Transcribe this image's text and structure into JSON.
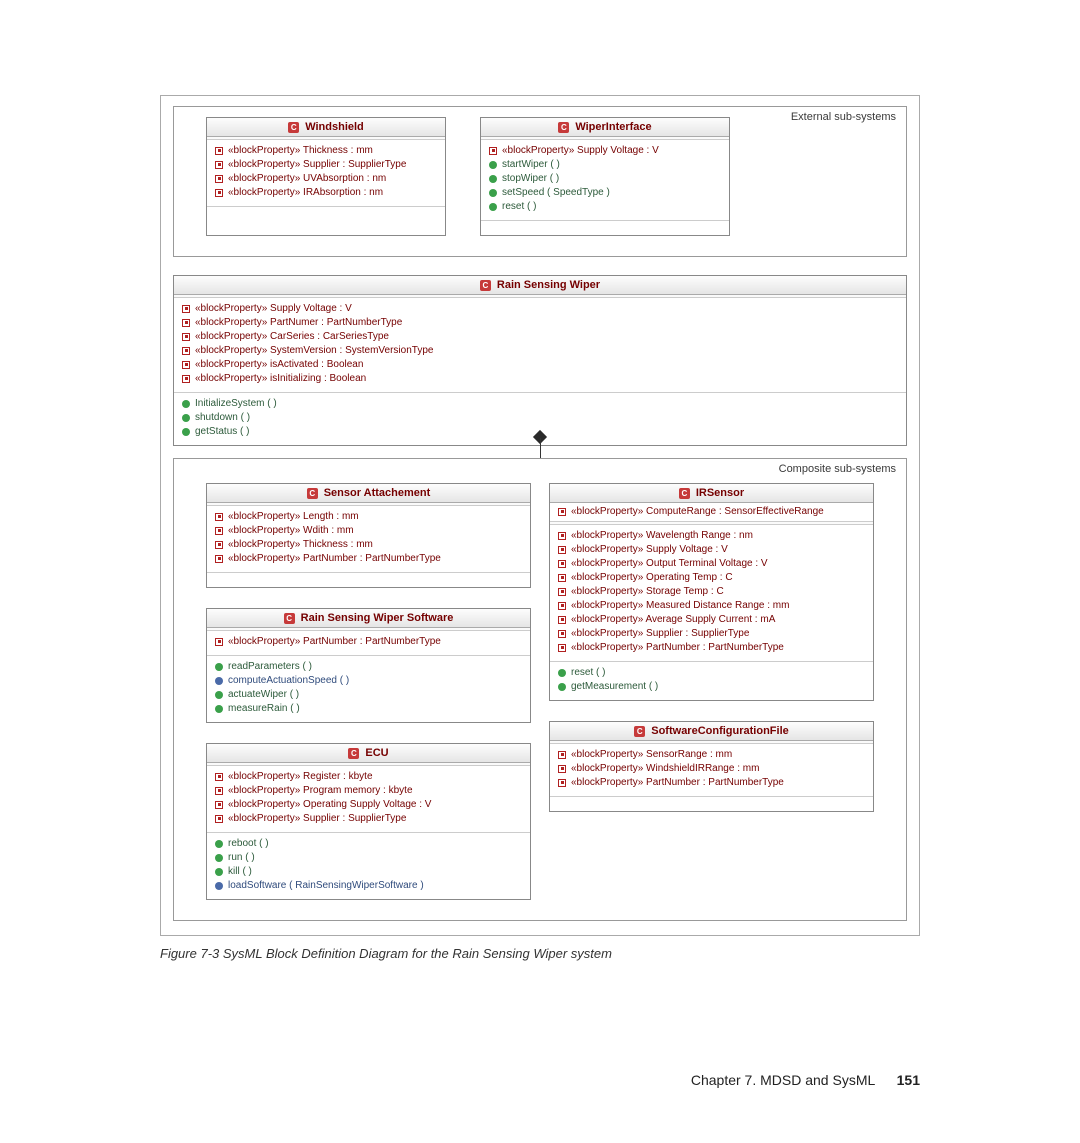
{
  "caption": "Figure 7-3   SysML Block Definition Diagram for the Rain Sensing Wiper system",
  "footer_chapter": "Chapter 7. MDSD and SysML",
  "footer_page": "151",
  "pkg_external_label": "External sub-systems",
  "pkg_composite_label": "Composite sub-systems",
  "windshield": {
    "title": "Windshield",
    "props": [
      "«blockProperty» Thickness : mm",
      "«blockProperty» Supplier : SupplierType",
      "«blockProperty» UVAbsorption : nm",
      "«blockProperty» IRAbsorption : nm"
    ]
  },
  "wiper_interface": {
    "title": "WiperInterface",
    "props": [
      "«blockProperty» Supply Voltage : V"
    ],
    "ops": [
      "startWiper ( )",
      "stopWiper ( )",
      "setSpeed ( SpeedType )",
      "reset ( )"
    ]
  },
  "rain_sensing_wiper": {
    "title": "Rain Sensing Wiper",
    "props": [
      "«blockProperty» Supply Voltage : V",
      "«blockProperty» PartNumer : PartNumberType",
      "«blockProperty» CarSeries : CarSeriesType",
      "«blockProperty» SystemVersion : SystemVersionType",
      "«blockProperty» isActivated : Boolean",
      "«blockProperty» isInitializing : Boolean"
    ],
    "ops": [
      "InitializeSystem ( )",
      "shutdown ( )",
      "getStatus ( )"
    ]
  },
  "sensor_attach": {
    "title": "Sensor Attachement",
    "props": [
      "«blockProperty» Length : mm",
      "«blockProperty» Wdith : mm",
      "«blockProperty» Thickness : mm",
      "«blockProperty» PartNumber : PartNumberType"
    ]
  },
  "rsw_software": {
    "title": "Rain Sensing Wiper Software",
    "props": [
      "«blockProperty» PartNumber : PartNumberType"
    ],
    "ops": [
      "readParameters ( )",
      "computeActuationSpeed ( )",
      "actuateWiper ( )",
      "measureRain ( )"
    ]
  },
  "ecu": {
    "title": "ECU",
    "props": [
      "«blockProperty» Register : kbyte",
      "«blockProperty» Program memory : kbyte",
      "«blockProperty» Operating Supply Voltage : V",
      "«blockProperty» Supplier : SupplierType"
    ],
    "ops": [
      "reboot ( )",
      "run ( )",
      "kill ( )",
      "loadSoftware ( RainSensingWiperSoftware )"
    ]
  },
  "irsensor": {
    "title": "IRSensor",
    "head_prop": "«blockProperty» ComputeRange : SensorEffectiveRange",
    "props": [
      "«blockProperty» Wavelength Range : nm",
      "«blockProperty» Supply Voltage : V",
      "«blockProperty» Output Terminal Voltage : V",
      "«blockProperty» Operating Temp : C",
      "«blockProperty» Storage Temp : C",
      "«blockProperty» Measured Distance Range : mm",
      "«blockProperty» Average Supply Current : mA",
      "«blockProperty» Supplier : SupplierType",
      "«blockProperty» PartNumber : PartNumberType"
    ],
    "ops": [
      "reset ( )",
      "getMeasurement ( )"
    ]
  },
  "swcfg": {
    "title": "SoftwareConfigurationFile",
    "props": [
      "«blockProperty» SensorRange : mm",
      "«blockProperty» WindshieldIRRange : mm",
      "«blockProperty» PartNumber : PartNumberType"
    ]
  }
}
